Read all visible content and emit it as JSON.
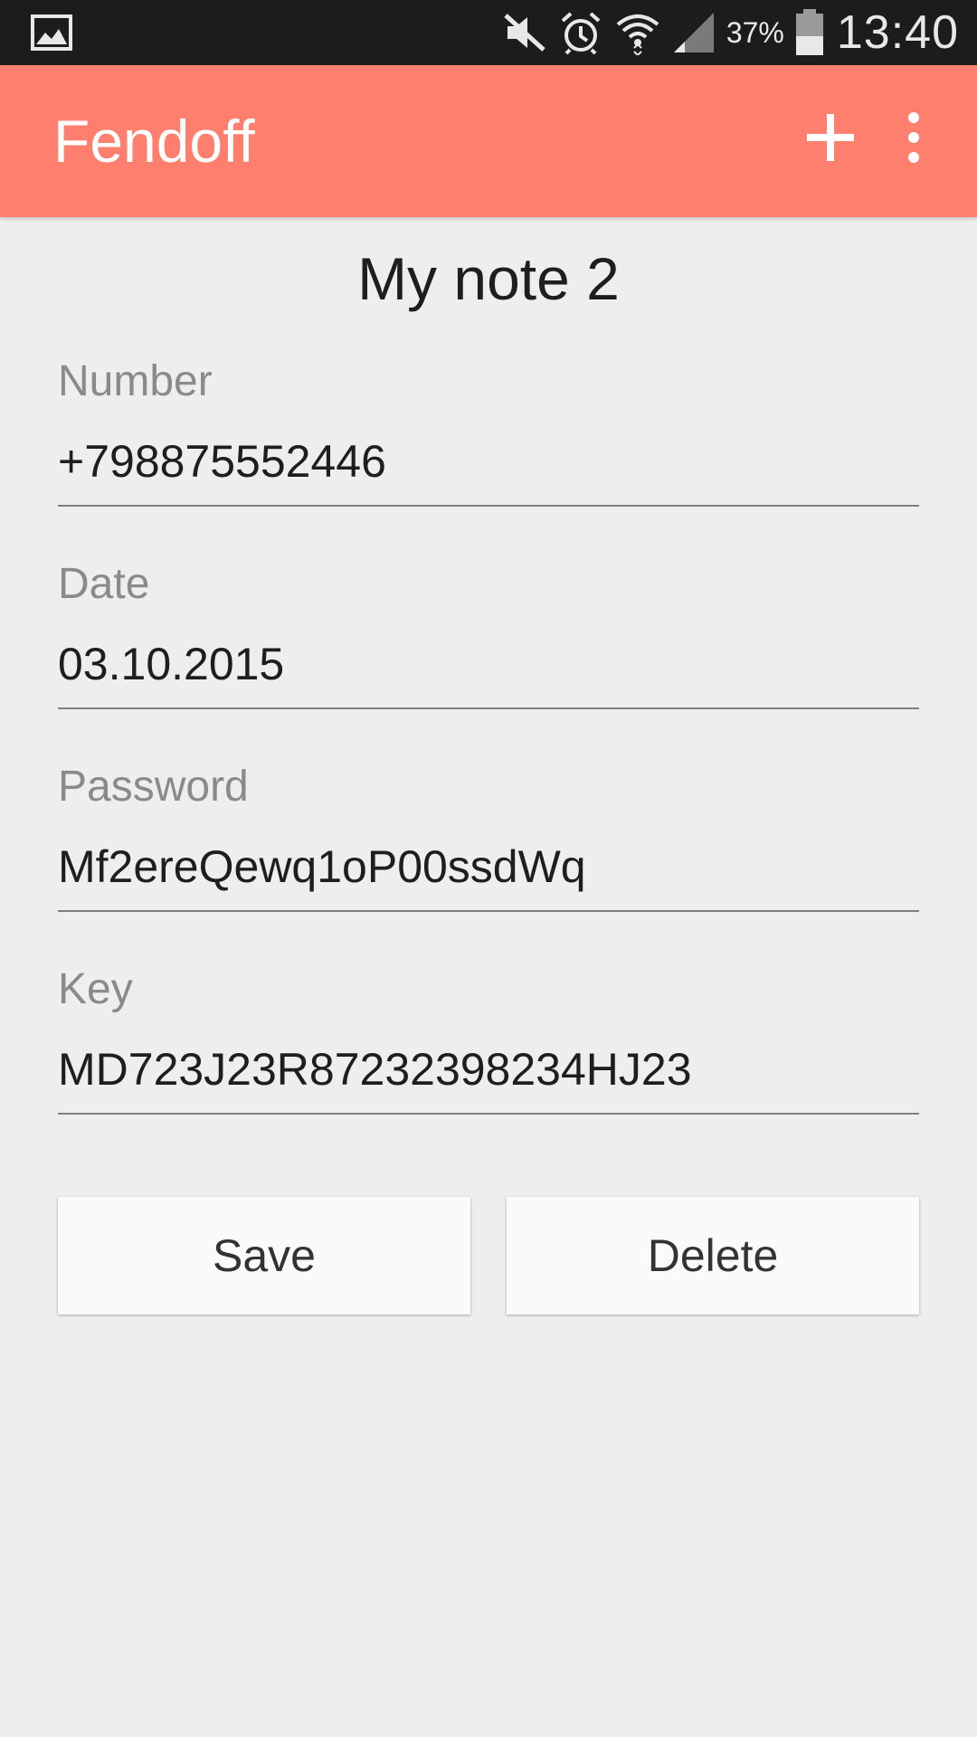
{
  "status_bar": {
    "battery_percent": "37%",
    "time": "13:40",
    "icons": [
      "gallery-icon",
      "mute-icon",
      "alarm-icon",
      "wifi-icon",
      "signal-icon",
      "battery-icon"
    ]
  },
  "app_bar": {
    "title": "Fendoff",
    "actions": [
      "add-icon",
      "more-vert-icon"
    ],
    "color": "#ff7f6e"
  },
  "note": {
    "title": "My note 2",
    "fields": [
      {
        "label": "Number",
        "value": "+798875552446"
      },
      {
        "label": "Date",
        "value": "03.10.2015"
      },
      {
        "label": "Password",
        "value": "Mf2ereQewq1oP00ssdWq"
      },
      {
        "label": "Key",
        "value": "MD723J23R87232398234HJ23"
      }
    ]
  },
  "buttons": {
    "save_label": "Save",
    "delete_label": "Delete"
  }
}
